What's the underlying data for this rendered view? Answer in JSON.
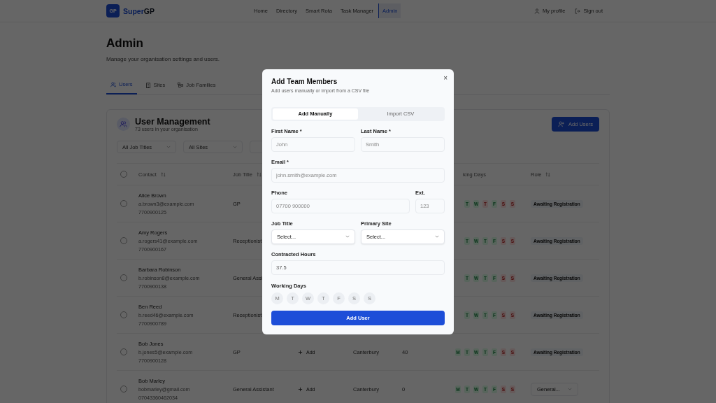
{
  "nav": {
    "logo": {
      "badge": "GP",
      "name_a": "Super",
      "name_b": "GP"
    },
    "links": [
      {
        "label": "Home",
        "selected": false
      },
      {
        "label": "Directory",
        "selected": false
      },
      {
        "label": "Smart Rota",
        "selected": false
      },
      {
        "label": "Task Manager",
        "selected": false
      },
      {
        "label": "Admin",
        "selected": true
      }
    ],
    "profile": "My profile",
    "sign_out": "Sign out"
  },
  "page": {
    "title": "Admin",
    "subtitle": "Manage your organisation settings and users."
  },
  "tabs": [
    {
      "label": "Users",
      "selected": true
    },
    {
      "label": "Sites",
      "selected": false
    },
    {
      "label": "Job Families",
      "selected": false
    }
  ],
  "card": {
    "title": "User Management",
    "subtitle": "73 users in your organisation",
    "add_button": "Add Users",
    "filters": [
      {
        "kind": "select",
        "label": "All Job Titles"
      },
      {
        "kind": "select",
        "label": "All Sites"
      },
      {
        "kind": "select"
      }
    ],
    "select_all": {
      "selected": false
    },
    "header": {
      "contact": {
        "label": "Contact",
        "sortable": true
      },
      "job_title": {
        "label": "Job Title",
        "sortable": true
      },
      "working_days": {
        "label": "king Days"
      },
      "role": {
        "label": "Role",
        "sortable": true
      }
    },
    "rows": [
      {
        "selected": false,
        "name": "Alice Brown",
        "email": "a.brown3@example.com",
        "phone": "7700900125",
        "job_title": "GP",
        "days": [
          {
            "letter": "T",
            "on": true
          },
          {
            "letter": "W",
            "on": true
          },
          {
            "letter": "T",
            "on": false
          },
          {
            "letter": "F",
            "on": true
          },
          {
            "letter": "S",
            "on": false
          },
          {
            "letter": "S",
            "on": false
          }
        ],
        "role": {
          "kind": "badge",
          "label": "Awaiting Registration"
        }
      },
      {
        "selected": false,
        "name": "Amy Rogers",
        "email": "a.rogers41@example.com",
        "phone": "7700900167",
        "job_title": "Receptionist",
        "days": [
          {
            "letter": "T",
            "on": true
          },
          {
            "letter": "W",
            "on": true
          },
          {
            "letter": "T",
            "on": true
          },
          {
            "letter": "F",
            "on": true
          },
          {
            "letter": "S",
            "on": false
          },
          {
            "letter": "S",
            "on": false
          }
        ],
        "role": {
          "kind": "badge",
          "label": "Awaiting Registration"
        }
      },
      {
        "selected": false,
        "name": "Barbara Robinson",
        "email": "b.robinson8@example.com",
        "phone": "7700900138",
        "job_title": "General Assi",
        "days": [
          {
            "letter": "T",
            "on": true
          },
          {
            "letter": "W",
            "on": true
          },
          {
            "letter": "T",
            "on": true
          },
          {
            "letter": "F",
            "on": true
          },
          {
            "letter": "S",
            "on": false
          },
          {
            "letter": "S",
            "on": false
          }
        ],
        "role": {
          "kind": "badge",
          "label": "Awaiting Registration"
        }
      },
      {
        "selected": false,
        "name": "Ben Reed",
        "email": "b.reed46@example.com",
        "phone": "7700900789",
        "job_title": "Receptionist",
        "days": [
          {
            "letter": "T",
            "on": true
          },
          {
            "letter": "W",
            "on": true
          },
          {
            "letter": "T",
            "on": true
          },
          {
            "letter": "F",
            "on": true
          },
          {
            "letter": "S",
            "on": false
          },
          {
            "letter": "S",
            "on": false
          }
        ],
        "role": {
          "kind": "badge",
          "label": "Awaiting Registration"
        }
      },
      {
        "selected": false,
        "name": "Bob Jones",
        "email": "b.jones5@example.com",
        "phone": "7700900128",
        "job_title": "GP",
        "add_label": "Add",
        "site": "Canterbury",
        "hours": "40",
        "days": [
          {
            "letter": "M",
            "on": true
          },
          {
            "letter": "T",
            "on": true
          },
          {
            "letter": "W",
            "on": true
          },
          {
            "letter": "T",
            "on": true
          },
          {
            "letter": "F",
            "on": true
          },
          {
            "letter": "S",
            "on": false
          },
          {
            "letter": "S",
            "on": false
          }
        ],
        "role": {
          "kind": "badge",
          "label": "Awaiting Registration"
        }
      },
      {
        "selected": false,
        "name": "Bob Marley",
        "email": "bobmarley@gmail.com",
        "phone": "07043360462034",
        "job_title": "General Assistant",
        "add_label": "Add",
        "site": "Canterbury",
        "hours": "0",
        "days": [
          {
            "letter": "M",
            "on": true
          },
          {
            "letter": "T",
            "on": true
          },
          {
            "letter": "W",
            "on": true
          },
          {
            "letter": "T",
            "on": true
          },
          {
            "letter": "F",
            "on": true
          },
          {
            "letter": "S",
            "on": false
          },
          {
            "letter": "S",
            "on": false
          }
        ],
        "role": {
          "kind": "select",
          "label": "General..."
        }
      }
    ]
  },
  "modal": {
    "title": "Add Team Members",
    "subtitle": "Add users manually or import from a CSV file",
    "close": "×",
    "tabs": [
      {
        "label": "Add Manually",
        "selected": true
      },
      {
        "label": "Import CSV",
        "selected": false
      }
    ],
    "rows": [
      [
        {
          "kind": "text",
          "label": "First Name *",
          "placeholder": "John"
        },
        {
          "kind": "text",
          "label": "Last Name *",
          "placeholder": "Smith"
        }
      ],
      [
        {
          "kind": "text",
          "label": "Email *",
          "placeholder": "john.smith@example.com"
        }
      ],
      [
        {
          "kind": "text",
          "label": "Phone",
          "placeholder": "07700 900000"
        },
        {
          "kind": "short",
          "label": "Ext.",
          "placeholder": "123"
        }
      ],
      [
        {
          "kind": "select",
          "label": "Job Title",
          "value": "Select..."
        },
        {
          "kind": "select",
          "label": "Primary Site",
          "value": "Select..."
        }
      ],
      [
        {
          "kind": "text",
          "label": "Contracted Hours",
          "value": "37.5"
        }
      ]
    ],
    "working_days": {
      "label": "Working Days",
      "days": [
        {
          "letter": "M",
          "selected": false
        },
        {
          "letter": "T",
          "selected": false
        },
        {
          "letter": "W",
          "selected": false
        },
        {
          "letter": "T",
          "selected": false
        },
        {
          "letter": "F",
          "selected": false
        },
        {
          "letter": "S",
          "selected": false
        },
        {
          "letter": "S",
          "selected": false
        }
      ]
    },
    "submit": "Add User"
  }
}
